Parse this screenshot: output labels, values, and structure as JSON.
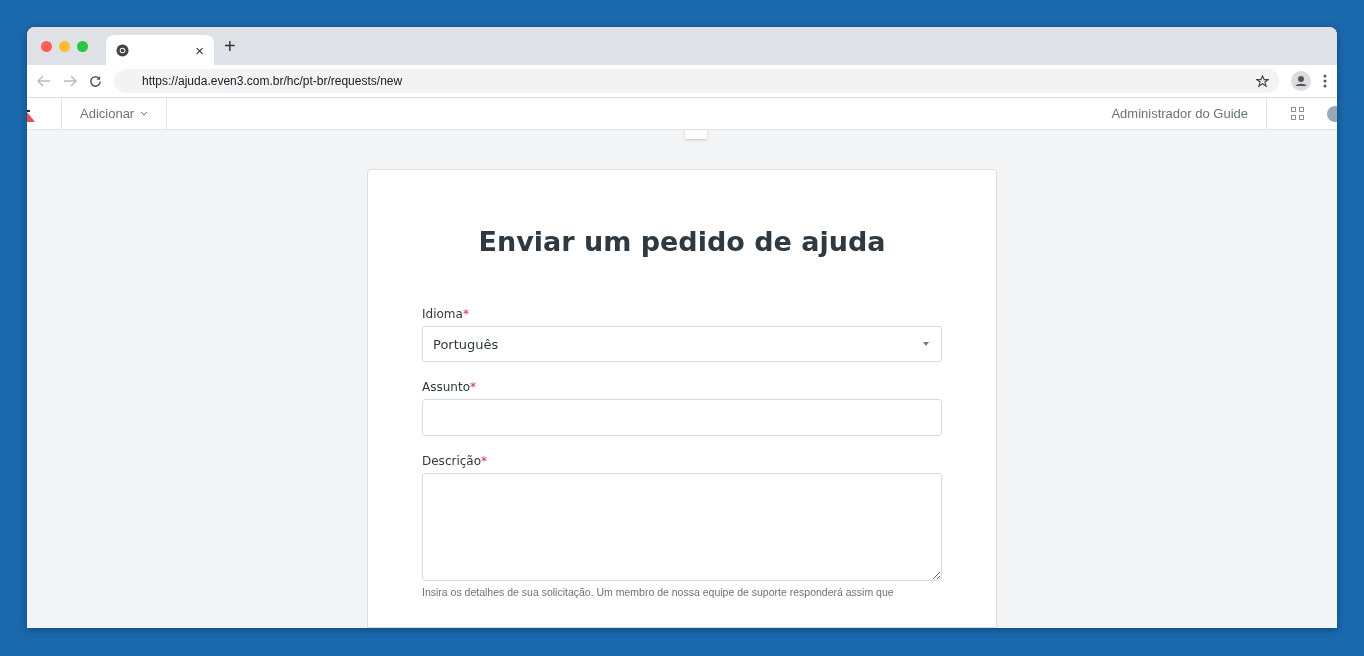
{
  "browser": {
    "tab": {
      "close": "×"
    },
    "new_tab": "+",
    "url": "https://ajuda.even3.com.br/hc/pt-br/requests/new"
  },
  "nav": {
    "add_menu": "Adicionar",
    "user": "Administrador do Guide"
  },
  "form": {
    "title": "Enviar um pedido de ajuda",
    "fields": [
      {
        "kind": "select",
        "label": "Idioma",
        "required_mark": "*",
        "value": "Português"
      },
      {
        "kind": "input",
        "label": "Assunto",
        "required_mark": "*"
      },
      {
        "kind": "textarea",
        "label": "Descrição",
        "required_mark": "*",
        "hint": "Insira os detalhes de sua solicitação. Um membro de nossa equipe de suporte responderá assim que"
      }
    ]
  }
}
